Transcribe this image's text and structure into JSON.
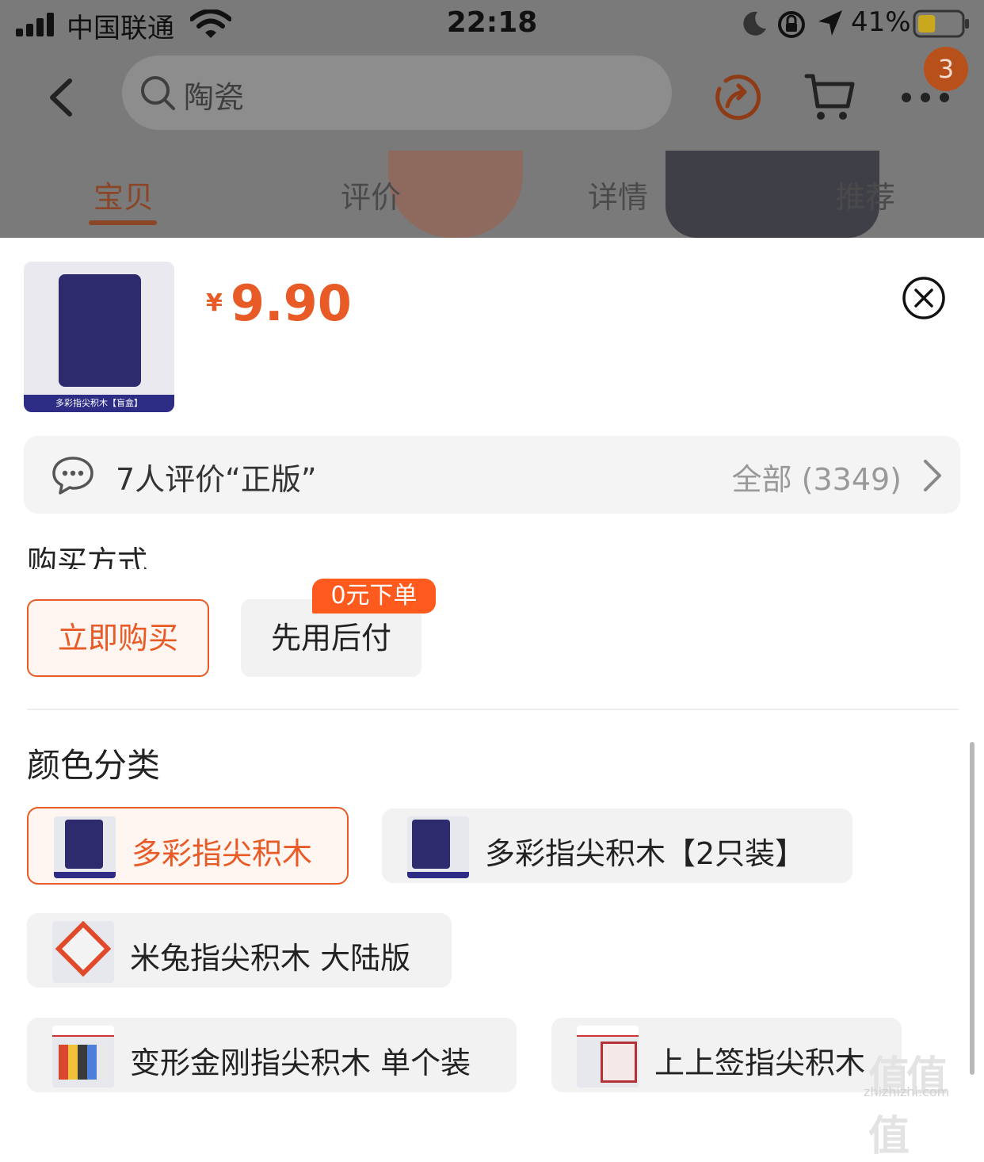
{
  "status_bar": {
    "carrier": "中国联通",
    "time": "22:18",
    "battery_percent": "41%",
    "battery_level": 0.41
  },
  "header": {
    "search_text": "陶瓷",
    "more_badge": "3",
    "icons": [
      "back-icon",
      "search-icon",
      "share-icon",
      "cart-icon",
      "more-icon"
    ]
  },
  "tabs": [
    {
      "label": "宝贝",
      "active": true
    },
    {
      "label": "评价",
      "active": false
    },
    {
      "label": "详情",
      "active": false
    },
    {
      "label": "推荐",
      "active": false
    }
  ],
  "sheet": {
    "thumb_caption": "多彩指尖积木【盲盒】",
    "price_symbol": "¥",
    "price": "9.90",
    "review": {
      "summary": "7人评价“正版”",
      "all_count": "全部 (3349)"
    },
    "buy_method": {
      "title": "购买方式",
      "options": [
        {
          "label": "立即购买",
          "selected": true
        },
        {
          "label": "先用后付",
          "badge": "0元下单",
          "selected": false
        }
      ]
    },
    "color_category": {
      "title": "颜色分类",
      "options": [
        {
          "label": "多彩指尖积木",
          "selected": true
        },
        {
          "label": "多彩指尖积木【2只装】",
          "selected": false
        },
        {
          "label": "米兔指尖积木 大陆版",
          "selected": false
        },
        {
          "label": "变形金刚指尖积木 单个装",
          "selected": false
        },
        {
          "label": "上上签指尖积木",
          "selected": false
        }
      ]
    }
  },
  "watermark": {
    "text": "值值值",
    "url": "zhizhizhi.com"
  },
  "colors": {
    "accent": "#e85a26",
    "overlay": "#7a7a7a",
    "chip_bg": "#f2f2f2",
    "selected_chip_bg": "#fff5f1"
  }
}
